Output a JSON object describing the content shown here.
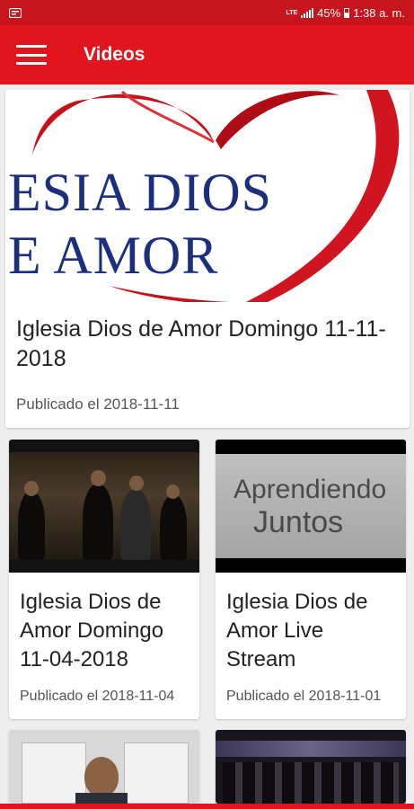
{
  "status_bar": {
    "network": "LTE",
    "battery": "45%",
    "time": "1:38 a. m."
  },
  "app_bar": {
    "title": "Videos"
  },
  "videos": [
    {
      "thumbnail": {
        "line1": "ESIA DIOS",
        "line2": "E AMOR"
      },
      "title": "Iglesia Dios de Amor Domingo 11-11-2018",
      "date": "Publicado el 2018-11-11"
    },
    {
      "title": "Iglesia Dios de Amor Domingo 11-04-2018",
      "date": "Publicado el 2018-11-04"
    },
    {
      "thumbnail": {
        "line1": "Aprendiendo",
        "line2": "Juntos"
      },
      "title": "Iglesia Dios de Amor Live Stream",
      "date": "Publicado el 2018-11-01"
    }
  ],
  "colors": {
    "primary": "#e2141e",
    "status_bar": "#c8141c",
    "background": "#eeeeee"
  }
}
